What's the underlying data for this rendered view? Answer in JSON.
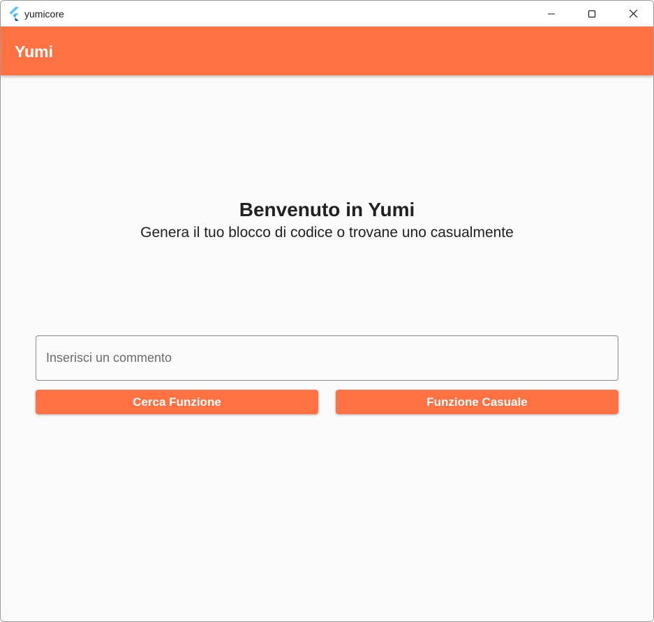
{
  "window": {
    "title": "yumicore",
    "controls": {
      "minimize_icon": "minimize-icon",
      "maximize_icon": "maximize-icon",
      "close_icon": "close-icon"
    }
  },
  "appbar": {
    "title": "Yumi"
  },
  "main": {
    "heading": "Benvenuto in Yumi",
    "subheading": "Genera il tuo blocco di codice o trovane uno casualmente",
    "comment_input": {
      "value": "",
      "placeholder": "Inserisci un commento"
    },
    "search_button_label": "Cerca Funzione",
    "random_button_label": "Funzione Casuale"
  },
  "colors": {
    "accent": "#ff7043",
    "background": "#fafafa",
    "text": "#212121"
  }
}
